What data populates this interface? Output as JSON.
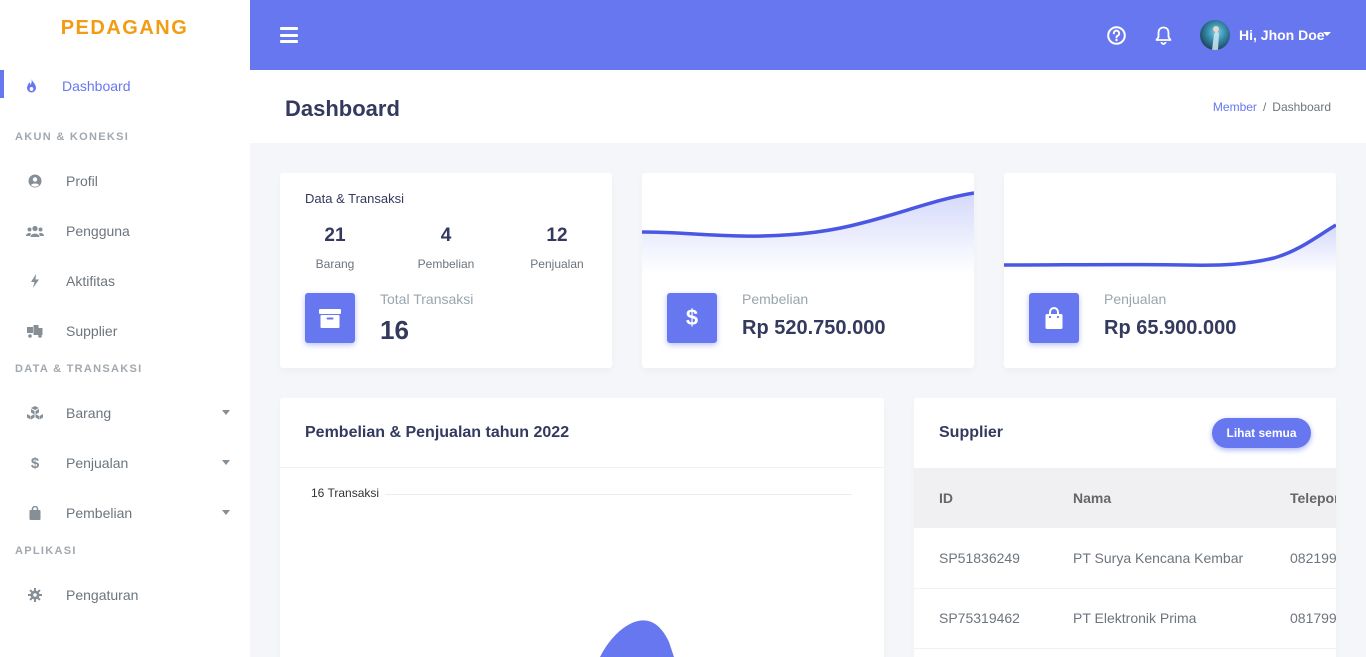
{
  "brand": "PEDAGANG",
  "sidebar": {
    "dashboard": "Dashboard",
    "section1": "AKUN & KONEKSI",
    "profil": "Profil",
    "pengguna": "Pengguna",
    "aktifitas": "Aktifitas",
    "supplier": "Supplier",
    "section2": "DATA & TRANSAKSI",
    "barang": "Barang",
    "penjualan": "Penjualan",
    "pembelian": "Pembelian",
    "section3": "APLIKASI",
    "pengaturan": "Pengaturan"
  },
  "topbar": {
    "user": "Hi, Jhon Doe"
  },
  "header": {
    "title": "Dashboard",
    "crumb1": "Member",
    "crumb_sep": "/",
    "crumb2": "Dashboard"
  },
  "stats": {
    "title": "Data & Transaksi",
    "barang_count": "21",
    "barang_label": "Barang",
    "pembelian_count": "4",
    "pembelian_label": "Pembelian",
    "penjualan_count": "12",
    "penjualan_label": "Penjualan",
    "total_label": "Total Transaksi",
    "total_value": "16"
  },
  "pembelian_card": {
    "label": "Pembelian",
    "value": "Rp 520.750.000"
  },
  "penjualan_card": {
    "label": "Penjualan",
    "value": "Rp 65.900.000"
  },
  "chart_card": {
    "title": "Pembelian & Penjualan tahun 2022",
    "axis_label": "16 Transaksi"
  },
  "supplier_card": {
    "title": "Supplier",
    "button": "Lihat semua",
    "columns": [
      "ID",
      "Nama",
      "Telepon"
    ],
    "rows": [
      {
        "id": "SP51836249",
        "nama": "PT Surya Kencana Kembar",
        "telepon": "082199"
      },
      {
        "id": "SP75319462",
        "nama": "PT Elektronik Prima",
        "telepon": "081799"
      }
    ]
  },
  "colors": {
    "primary": "#6777ef",
    "brand": "#f39c12"
  }
}
